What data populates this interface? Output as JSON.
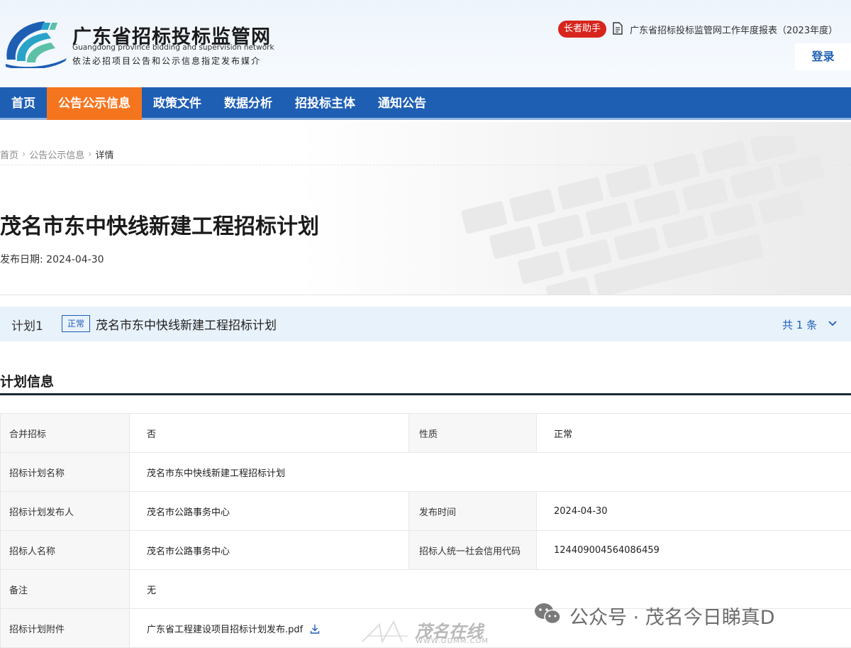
{
  "header": {
    "site_title": "广东省招标投标监管网",
    "site_subtitle_en": "Guangdong province bidding and supervision network",
    "site_slogan": "依法必招项目公告和公示信息指定发布媒介",
    "assistant_label": "长者助手",
    "report_link": "广东省招标投标监管网工作年度报表（2023年度）",
    "login_label": "登录"
  },
  "nav": {
    "items": [
      "首页",
      "公告公示信息",
      "政策文件",
      "数据分析",
      "招投标主体",
      "通知公告"
    ],
    "active_index": 1
  },
  "breadcrumb": {
    "home": "首页",
    "section": "公告公示信息",
    "current": "详情",
    "separator": "›"
  },
  "page": {
    "title": "茂名市东中快线新建工程招标计划",
    "publish_date": "发布日期: 2024-04-30"
  },
  "plan_bar": {
    "label": "计划1",
    "status_tag": "正常",
    "name": "茂名市东中快线新建工程招标计划",
    "count": "共 1 条"
  },
  "section": {
    "title": "计划信息"
  },
  "info_table": {
    "merged_bidding_label": "合并招标",
    "merged_bidding_value": "否",
    "nature_label": "性质",
    "nature_value": "正常",
    "plan_name_label": "招标计划名称",
    "plan_name_value": "茂名市东中快线新建工程招标计划",
    "publisher_label": "招标计划发布人",
    "publisher_value": "茂名市公路事务中心",
    "publish_time_label": "发布时间",
    "publish_time_value": "2024-04-30",
    "tenderer_label": "招标人名称",
    "tenderer_value": "茂名市公路事务中心",
    "credit_code_label": "招标人统一社会信用代码",
    "credit_code_value": "124409004564086459",
    "remark_label": "备注",
    "remark_value": "无",
    "attachment_label": "招标计划附件",
    "attachment_value": "广东省工程建设项目招标计划发布.pdf"
  },
  "watermark": {
    "site_logo_text": "茂名在线",
    "site_url": "WWW.GDMM.COM",
    "wechat_text": "公众号 · 茂名今日睇真D"
  },
  "colors": {
    "nav_blue": "#1e5fb4",
    "nav_active_orange": "#f5751e",
    "assistant_red": "#d7251d",
    "plan_bar_bg": "#e8f2fb"
  }
}
